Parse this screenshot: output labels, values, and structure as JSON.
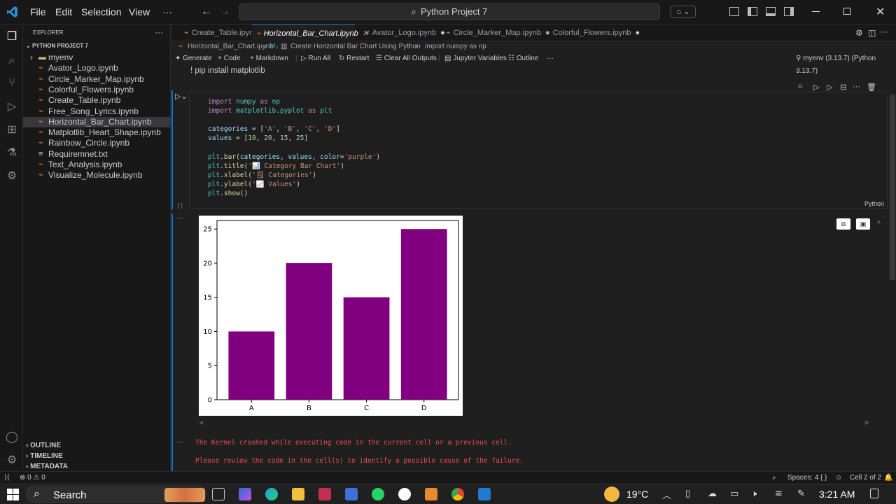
{
  "menu": {
    "file": "File",
    "edit": "Edit",
    "selection": "Selection",
    "view": "View",
    "more": "···"
  },
  "command_center": "Python Project 7",
  "sidebar": {
    "header": "EXPLORER",
    "project": "PYTHON PROJECT 7",
    "files": [
      {
        "name": "myenv",
        "kind": "folder"
      },
      {
        "name": "Avator_Logo.ipynb"
      },
      {
        "name": "Circle_Marker_Map.ipynb"
      },
      {
        "name": "Colorful_Flowers.ipynb"
      },
      {
        "name": "Create_Table.ipynb"
      },
      {
        "name": "Free_Song_Lyrics.ipynb"
      },
      {
        "name": "Horizontal_Bar_Chart.ipynb",
        "active": true
      },
      {
        "name": "Matplotlib_Heart_Shape.ipynb"
      },
      {
        "name": "Rainbow_Circle.ipynb"
      },
      {
        "name": "Requiremnet.txt"
      },
      {
        "name": "Text_Analysis.ipynb"
      },
      {
        "name": "Visualize_Molecule.ipynb"
      }
    ],
    "outline": "OUTLINE",
    "timeline": "TIMELINE",
    "metadata": "METADATA"
  },
  "tabs": [
    {
      "label": "Create_Table.ipynb"
    },
    {
      "label": "Horizontal_Bar_Chart.ipynb",
      "active": true
    },
    {
      "label": "Avator_Logo.ipynb",
      "dirty": true
    },
    {
      "label": "Circle_Marker_Map.ipynb",
      "dirty": true
    },
    {
      "label": "Colorful_Flowers.ipynb",
      "dirty": true
    }
  ],
  "breadcrumb": {
    "file": "Horizontal_Bar_Chart.ipynb",
    "md": "M↓",
    "section": "Create Horizontal Bar Chart Using Python",
    "cell": "import numpy as np"
  },
  "toolbar": {
    "generate": "Generate",
    "code": "Code",
    "markdown": "Markdown",
    "run_all": "Run All",
    "restart": "Restart",
    "clear": "Clear All Outputs",
    "variables": "Jupyter Variables",
    "outline": "Outline",
    "kernel": "myenv (3.13.7) (Python 3.13.7)"
  },
  "prev_cell_text": "! pip install matplotlib",
  "code_lines": [
    "import numpy as np",
    "import matplotlib.pyplot as plt",
    "",
    "categories = ['A', 'B', 'C', 'D']",
    "values = [10, 20, 15, 25]",
    "",
    "plt.bar(categories, values, color='purple')",
    "plt.title('📊 Category Bar Chart')",
    "plt.xlabel('🗒 Categories')",
    "plt.ylabel('📈 Values')",
    "plt.show()"
  ],
  "cell_language": "Python",
  "exec_count": "[ ]",
  "errors": {
    "line1": "The Kernel crashed while executing code in the current cell or a previous cell.",
    "line2": "Please review the code in the cell(s) to identify a possible cause of the failure."
  },
  "chart_data": {
    "type": "bar",
    "categories": [
      "A",
      "B",
      "C",
      "D"
    ],
    "values": [
      10,
      20,
      15,
      25
    ],
    "ylim": [
      0,
      26.25
    ],
    "yticks": [
      0,
      5,
      10,
      15,
      20,
      25
    ],
    "bar_color": "#800080",
    "grid": false
  },
  "statusbar": {
    "errors": "⊗ 0 ⚠ 0",
    "spaces": "Spaces: 4",
    "braces": "{ }",
    "cell": "Cell 2 of 2"
  },
  "taskbar": {
    "search": "Search",
    "weather": "19°C",
    "time": "3:21 AM"
  },
  "colors": {
    "accent": "#0078d4",
    "error": "#f14c4c"
  }
}
